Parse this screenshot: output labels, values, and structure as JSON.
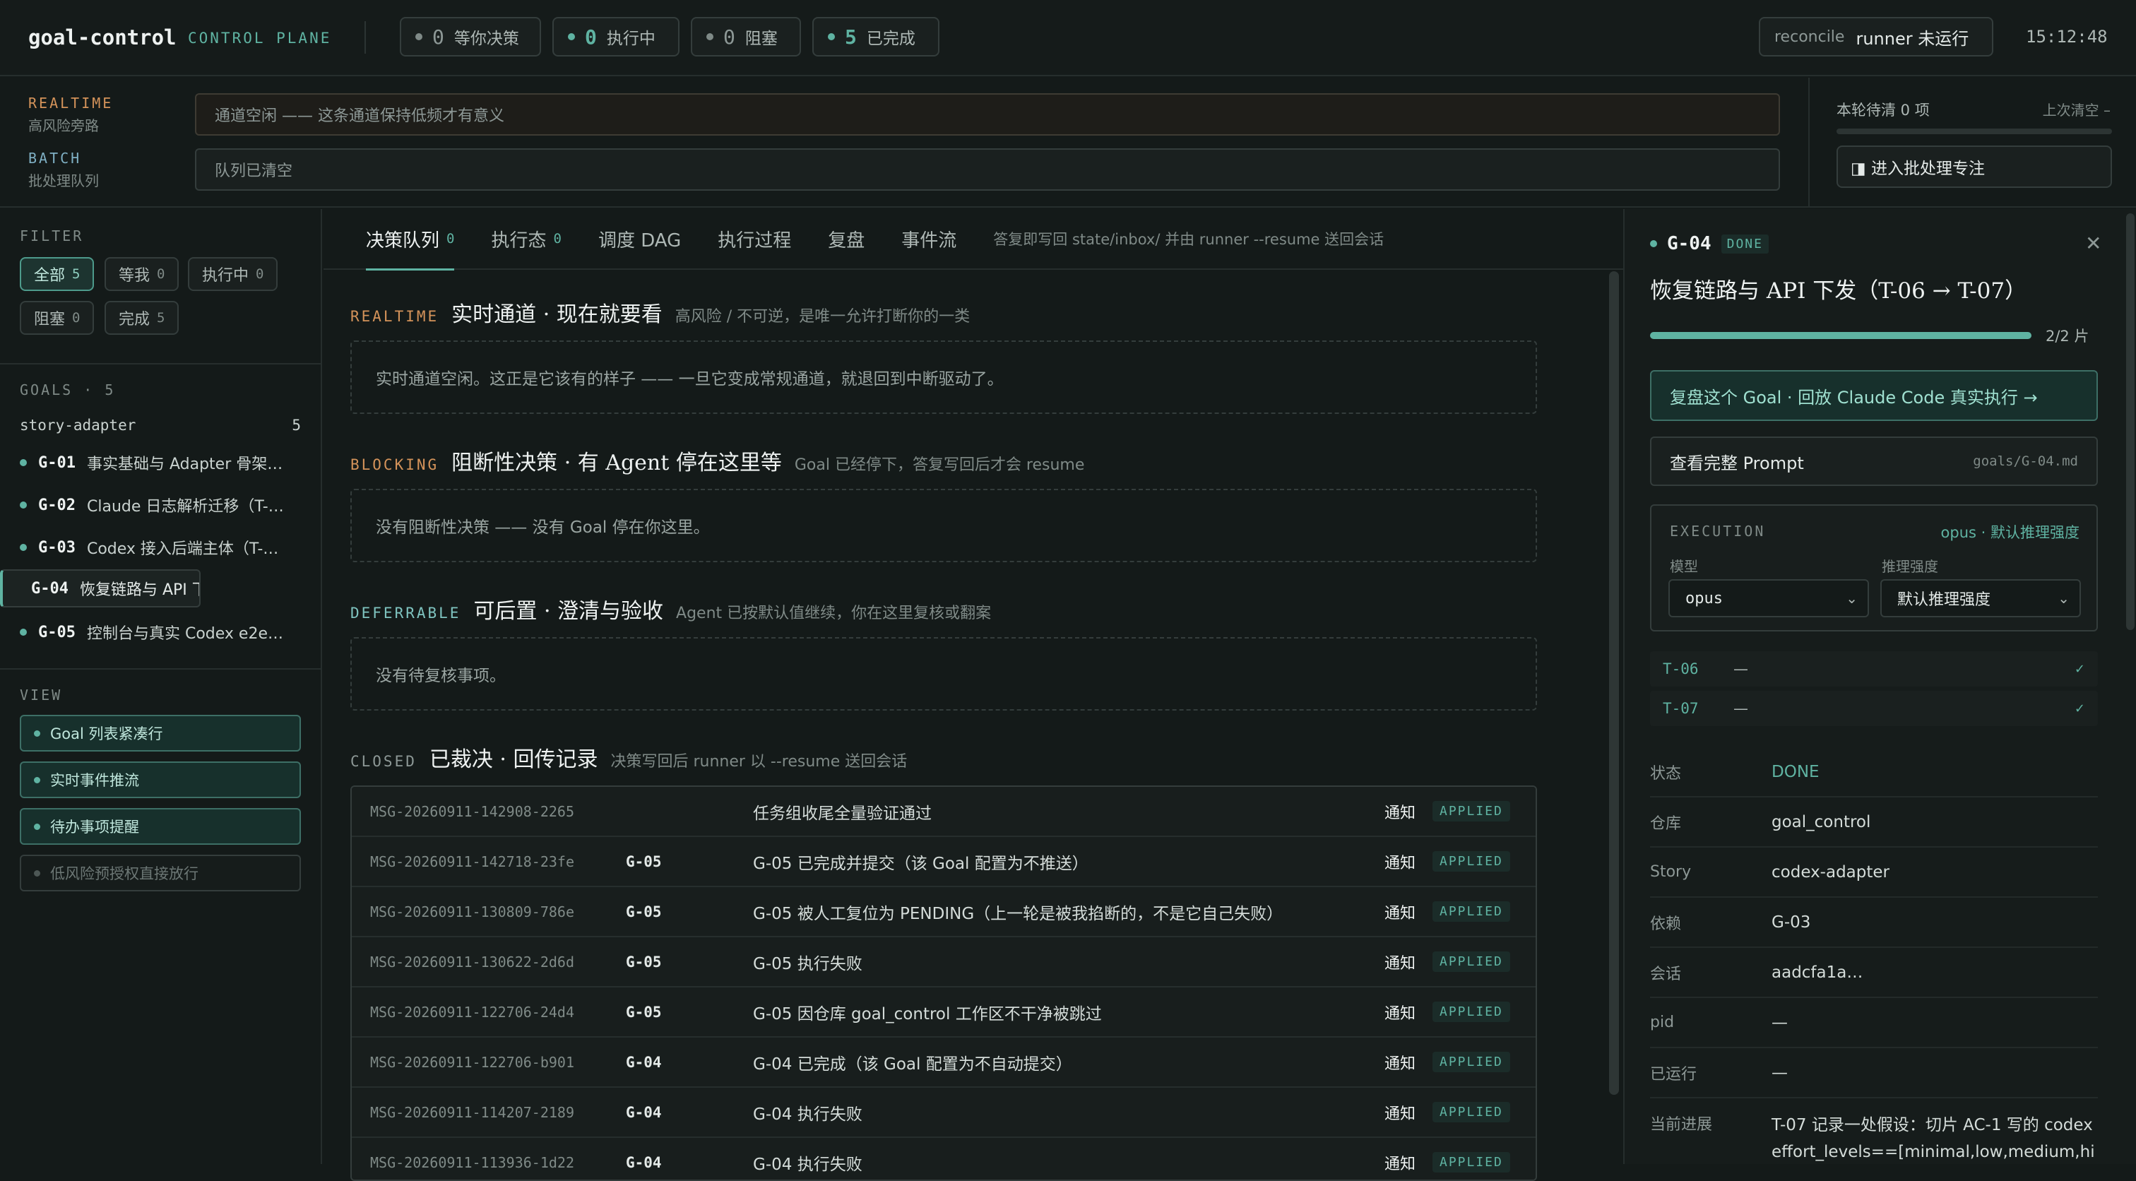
{
  "header": {
    "brand": "goal-control",
    "subtitle": "CONTROL PLANE",
    "stats": [
      {
        "count": "0",
        "label": "等你决策"
      },
      {
        "count": "0",
        "label": "执行中"
      },
      {
        "count": "0",
        "label": "阻塞"
      },
      {
        "count": "5",
        "label": "已完成"
      }
    ],
    "reconcile_label": "reconcile",
    "reconcile_value": "runner 未运行",
    "clock": "15:12:48"
  },
  "channels": {
    "realtime": {
      "tag": "REALTIME",
      "desc": "高风险旁路",
      "placeholder": "通道空闲 —— 这条通道保持低频才有意义"
    },
    "batch": {
      "tag": "BATCH",
      "desc": "批处理队列",
      "placeholder": "队列已清空"
    }
  },
  "batch_panel": {
    "pending": "本轮待清 0 项",
    "last_cleared": "上次清空 –",
    "progress": 0,
    "focus_button": "◨ 进入批处理专注"
  },
  "sidebar": {
    "filter_heading": "FILTER",
    "filters": [
      {
        "label": "全部",
        "count": "5"
      },
      {
        "label": "等我",
        "count": "0"
      },
      {
        "label": "执行中",
        "count": "0"
      },
      {
        "label": "阻塞",
        "count": "0"
      },
      {
        "label": "完成",
        "count": "5"
      }
    ],
    "goals_heading": "GOALS · 5",
    "story": {
      "name": "story-adapter",
      "count": "5"
    },
    "goals": [
      {
        "id": "G-01",
        "title": "事实基础与 Adapter 骨架…"
      },
      {
        "id": "G-02",
        "title": "Claude 日志解析迁移（T-…"
      },
      {
        "id": "G-03",
        "title": "Codex 接入后端主体（T-…"
      },
      {
        "id": "G-04",
        "title": "恢复链路与 API 下发（T-…"
      },
      {
        "id": "G-05",
        "title": "控制台与真实 Codex e2e…"
      }
    ],
    "view_heading": "VIEW",
    "views": [
      {
        "label": "Goal 列表紧凑行"
      },
      {
        "label": "实时事件推流"
      },
      {
        "label": "待办事项提醒"
      },
      {
        "label": "低风险预授权直接放行"
      }
    ]
  },
  "main": {
    "tabs": [
      {
        "label": "决策队列",
        "count": "0"
      },
      {
        "label": "执行态",
        "count": "0"
      },
      {
        "label": "调度 DAG"
      },
      {
        "label": "执行过程"
      },
      {
        "label": "复盘"
      },
      {
        "label": "事件流"
      }
    ],
    "hint": "答复即写回 state/inbox/ 并由 runner --resume 送回会话",
    "sections": {
      "realtime": {
        "tag": "REALTIME",
        "title": "实时通道 · 现在就要看",
        "sub": "高风险 / 不可逆，是唯一允许打断你的一类",
        "empty": "实时通道空闲。这正是它该有的样子 —— 一旦它变成常规通道，就退回到中断驱动了。"
      },
      "blocking": {
        "tag": "BLOCKING",
        "title": "阻断性决策 · 有 Agent 停在这里等",
        "sub": "Goal 已经停下，答复写回后才会 resume",
        "empty": "没有阻断性决策 —— 没有 Goal 停在你这里。"
      },
      "deferrable": {
        "tag": "DEFERRABLE",
        "title": "可后置 · 澄清与验收",
        "sub": "Agent 已按默认值继续，你在这里复核或翻案",
        "empty": "没有待复核事项。"
      },
      "closed": {
        "tag": "CLOSED",
        "title": "已裁决 · 回传记录",
        "sub": "决策写回后 runner 以 --resume 送回会话"
      }
    },
    "closed_rows": [
      {
        "msg": "MSG-20260911-142908-2265",
        "goal": "",
        "text": "任务组收尾全量验证通过",
        "kind": "通知",
        "status": "APPLIED"
      },
      {
        "msg": "MSG-20260911-142718-23fe",
        "goal": "G-05",
        "text": "G-05 已完成并提交（该 Goal 配置为不推送）",
        "kind": "通知",
        "status": "APPLIED"
      },
      {
        "msg": "MSG-20260911-130809-786e",
        "goal": "G-05",
        "text": "G-05 被人工复位为 PENDING（上一轮是被我掐断的，不是它自己失败）",
        "kind": "通知",
        "status": "APPLIED"
      },
      {
        "msg": "MSG-20260911-130622-2d6d",
        "goal": "G-05",
        "text": "G-05 执行失败",
        "kind": "通知",
        "status": "APPLIED"
      },
      {
        "msg": "MSG-20260911-122706-24d4",
        "goal": "G-05",
        "text": "G-05 因仓库 goal_control 工作区不干净被跳过",
        "kind": "通知",
        "status": "APPLIED"
      },
      {
        "msg": "MSG-20260911-122706-b901",
        "goal": "G-04",
        "text": "G-04 已完成（该 Goal 配置为不自动提交）",
        "kind": "通知",
        "status": "APPLIED"
      },
      {
        "msg": "MSG-20260911-114207-2189",
        "goal": "G-04",
        "text": "G-04 执行失败",
        "kind": "通知",
        "status": "APPLIED"
      },
      {
        "msg": "MSG-20260911-113936-1d22",
        "goal": "G-04",
        "text": "G-04 执行失败",
        "kind": "通知",
        "status": "APPLIED"
      }
    ]
  },
  "detail": {
    "id": "G-04",
    "status": "DONE",
    "title": "恢复链路与 API 下发（T-06 → T-07）",
    "progress": 1.0,
    "progress_text": "2/2 片",
    "replay_button": "复盘这个 Goal · 回放 Claude Code 真实执行 →",
    "prompt_button": "查看完整 Prompt",
    "prompt_path": "goals/G-04.md",
    "execution": {
      "heading": "EXECUTION",
      "summary": "opus · 默认推理强度",
      "model_label": "模型",
      "model_value": "opus",
      "effort_label": "推理强度",
      "effort_value": "默认推理强度"
    },
    "tasks": [
      {
        "id": "T-06",
        "value": "—",
        "check": "✓"
      },
      {
        "id": "T-07",
        "value": "—",
        "check": "✓"
      }
    ],
    "fields": [
      {
        "key": "状态",
        "value": "DONE"
      },
      {
        "key": "仓库",
        "value": "goal_control"
      },
      {
        "key": "Story",
        "value": "codex-adapter"
      },
      {
        "key": "依赖",
        "value": "G-03"
      },
      {
        "key": "会话",
        "value": "aadcfa1a…"
      },
      {
        "key": "pid",
        "value": "—"
      },
      {
        "key": "已运行",
        "value": "—"
      }
    ],
    "progress_label": "当前进展",
    "progress_note": "T-07 记录一处假设：切片 AC-1 写的 codex effort_levels==[minimal,low,medium,hi"
  },
  "colors": {
    "accent": "#5fb3a2",
    "realtime": "#d4935a",
    "batch": "#7fb0c4",
    "blocking": "#d4935a",
    "deferrable": "#7fc4c0",
    "closed": "#8d9896"
  },
  "icons": {
    "close": "close-icon",
    "chevron": "chevron-down-icon",
    "dot": "status-dot-icon"
  }
}
